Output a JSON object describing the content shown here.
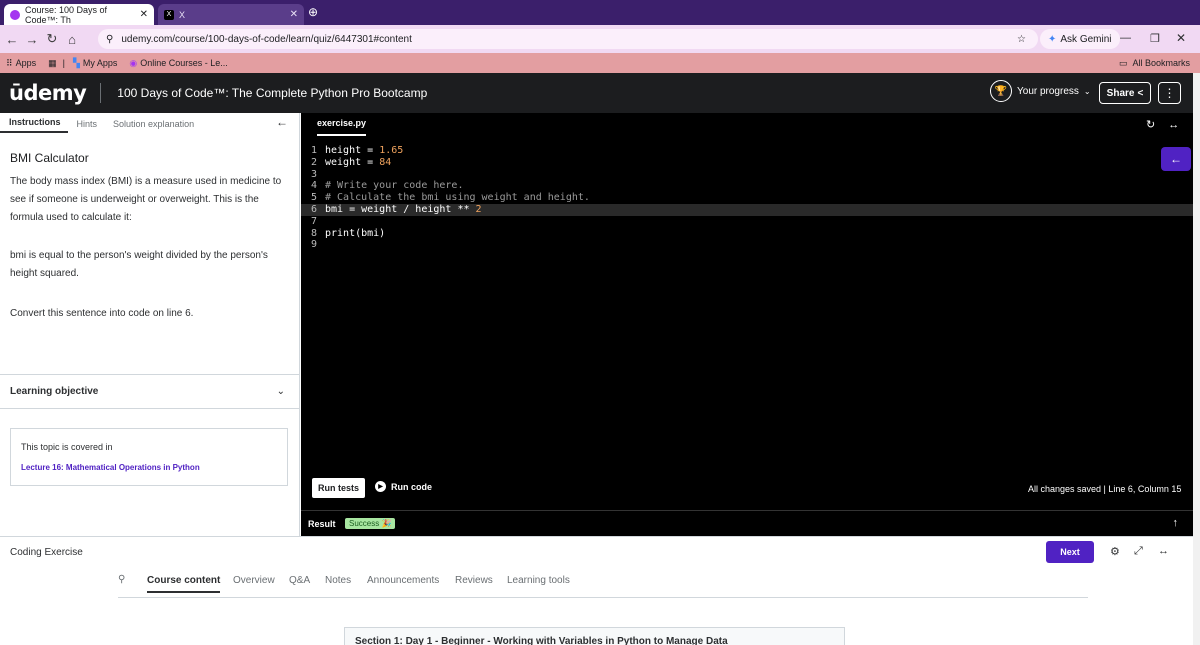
{
  "browser": {
    "tabs": [
      {
        "label": "Course: 100 Days of Code™: Th"
      },
      {
        "label": "X"
      }
    ],
    "url": "udemy.com/course/100-days-of-code/learn/quiz/6447301#content",
    "ask_gemini": "Ask Gemini",
    "bookmarks": [
      "Apps",
      "My Apps",
      "Online Courses - Le..."
    ],
    "all_bookmarks": "All Bookmarks"
  },
  "header": {
    "logo": "ūdemy",
    "course_title": "100 Days of Code™: The Complete Python Pro Bootcamp",
    "progress_label": "Your progress",
    "share_label": "Share"
  },
  "left_panel": {
    "tabs": [
      "Instructions",
      "Hints",
      "Solution explanation"
    ],
    "title": "BMI Calculator",
    "paragraphs": [
      "The body mass index (BMI) is a measure used in medicine to see if someone is underweight or overweight. This is the formula used to calculate it:",
      "bmi is equal to the person's weight divided by the person's height squared.",
      "Convert this sentence into code on line 6."
    ],
    "learning_objective": "Learning objective",
    "topic_label": "This topic is covered in",
    "topic_link": "Lecture 16: Mathematical Operations in Python"
  },
  "editor": {
    "filename": "exercise.py",
    "lines": [
      "height = 1.65",
      "weight = 84",
      "",
      "# Write your code here.",
      "# Calculate the bmi using weight and height.",
      "bmi = weight / height ** 2",
      "",
      "print(bmi)",
      ""
    ],
    "run_tests": "Run tests",
    "run_code": "Run code",
    "save_status": "All changes saved  |  Line 6, Column 15",
    "result_label": "Result",
    "result_status": "Success 🎉"
  },
  "bottom": {
    "coding_exercise": "Coding Exercise",
    "next_label": "Next"
  },
  "course_tabs": [
    "Course content",
    "Overview",
    "Q&A",
    "Notes",
    "Announcements",
    "Reviews",
    "Learning tools"
  ],
  "section_title": "Section 1: Day 1 - Beginner - Working with Variables in Python to Manage Data",
  "colors": {
    "accent": "#5022c3",
    "success": "#a8e6a1",
    "header": "#1c1d1f"
  }
}
